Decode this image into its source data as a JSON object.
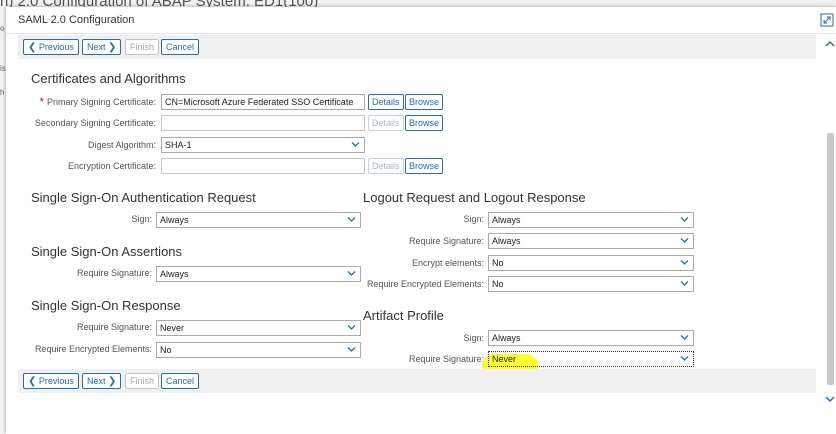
{
  "background": {
    "title": "n) 2.0 Configuration of ABAP System: ED1(100)",
    "edge_chars": [
      "o",
      "is",
      "h"
    ]
  },
  "dialog": {
    "title": "SAML 2.0 Configuration"
  },
  "toolbar": {
    "previous": "Previous",
    "next": "Next",
    "finish": "Finish",
    "cancel": "Cancel"
  },
  "certificates": {
    "title": "Certificates and Algorithms",
    "primary_label": "Primary Signing Certificate:",
    "primary_value": "CN=Microsoft Azure Federated SSO Certificate",
    "secondary_label": "Secondary Signing Certificate:",
    "secondary_value": "",
    "digest_label": "Digest Algorithm:",
    "digest_value": "SHA-1",
    "encryption_label": "Encryption Certificate:",
    "encryption_value": "",
    "details_label": "Details",
    "browse_label": "Browse"
  },
  "sso_request": {
    "title": "Single Sign-On Authentication Request",
    "sign_label": "Sign:",
    "sign_value": "Always"
  },
  "sso_assertions": {
    "title": "Single Sign-On Assertions",
    "req_sig_label": "Require Signature:",
    "req_sig_value": "Always"
  },
  "sso_response": {
    "title": "Single Sign-On Response",
    "req_sig_label": "Require Signature:",
    "req_sig_value": "Never",
    "req_enc_label": "Require Encrypted Elements:",
    "req_enc_value": "No"
  },
  "logout": {
    "title": "Logout Request and Logout Response",
    "sign_label": "Sign:",
    "sign_value": "Always",
    "req_sig_label": "Require Signature:",
    "req_sig_value": "Always",
    "encrypt_label": "Encrypt elements:",
    "encrypt_value": "No",
    "req_enc_label": "Require Encrypted Elements:",
    "req_enc_value": "No"
  },
  "artifact": {
    "title": "Artifact Profile",
    "sign_label": "Sign:",
    "sign_value": "Always",
    "req_sig_label": "Require Signature:",
    "req_sig_value": "Never"
  },
  "colors": {
    "accent": "#2a6bab",
    "required": "#cc0000",
    "highlight": "#ffff33"
  }
}
